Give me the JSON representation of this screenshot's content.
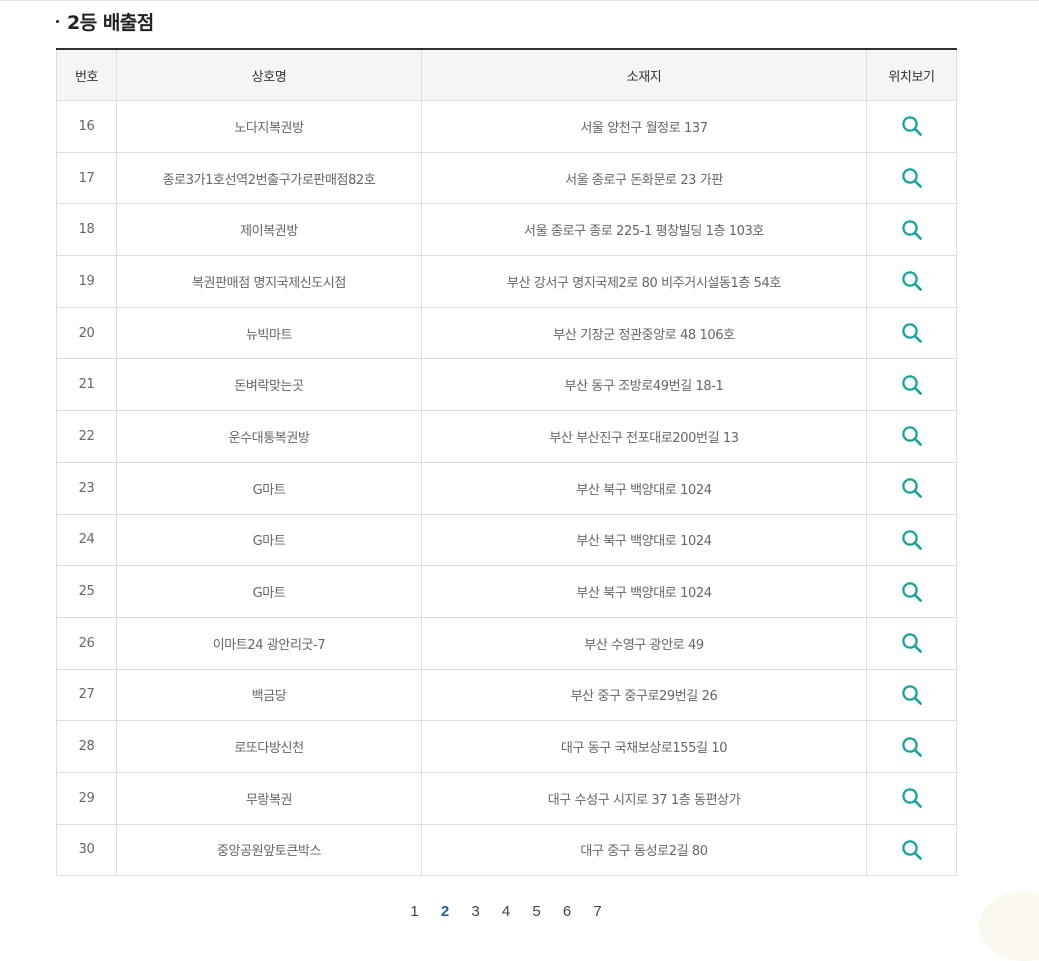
{
  "section": {
    "title": "2등 배출점"
  },
  "table": {
    "headers": {
      "no": "번호",
      "name": "상호명",
      "address": "소재지",
      "map": "위치보기"
    },
    "rows": [
      {
        "no": "16",
        "name": "노다지복권방",
        "address": "서울 양천구 월정로 137"
      },
      {
        "no": "17",
        "name": "종로3가1호선역2번출구가로판매점82호",
        "address": "서울 종로구 돈화문로 23 가판"
      },
      {
        "no": "18",
        "name": "제이복권방",
        "address": "서울 종로구 종로 225-1 평창빌딩 1층 103호"
      },
      {
        "no": "19",
        "name": "복권판매점 명지국제신도시점",
        "address": "부산 강서구 명지국제2로 80 비주거시설동1층 54호"
      },
      {
        "no": "20",
        "name": "뉴빅마트",
        "address": "부산 기장군 정관중앙로 48 106호"
      },
      {
        "no": "21",
        "name": "돈벼락맞는곳",
        "address": "부산 동구 조방로49번길 18-1"
      },
      {
        "no": "22",
        "name": "운수대통복권방",
        "address": "부산 부산진구 전포대로200번길 13"
      },
      {
        "no": "23",
        "name": "G마트",
        "address": "부산 북구 백양대로 1024"
      },
      {
        "no": "24",
        "name": "G마트",
        "address": "부산 북구 백양대로 1024"
      },
      {
        "no": "25",
        "name": "G마트",
        "address": "부산 북구 백양대로 1024"
      },
      {
        "no": "26",
        "name": "이마트24 광안리굿-7",
        "address": "부산 수영구 광안로 49"
      },
      {
        "no": "27",
        "name": "백금당",
        "address": "부산 중구 중구로29번길 26"
      },
      {
        "no": "28",
        "name": "로또다방신천",
        "address": "대구 동구 국채보상로155길 10"
      },
      {
        "no": "29",
        "name": "무랑복권",
        "address": "대구 수성구 시지로 37 1층 동편상가"
      },
      {
        "no": "30",
        "name": "중앙공원앞토큰박스",
        "address": "대구 중구 동성로2길 80"
      }
    ]
  },
  "icons": {
    "map": "search-icon"
  },
  "colors": {
    "accent": "#17a39a",
    "current_page": "#1f5fa6"
  },
  "pagination": {
    "pages": [
      "1",
      "2",
      "3",
      "4",
      "5",
      "6",
      "7"
    ],
    "current": "2"
  }
}
